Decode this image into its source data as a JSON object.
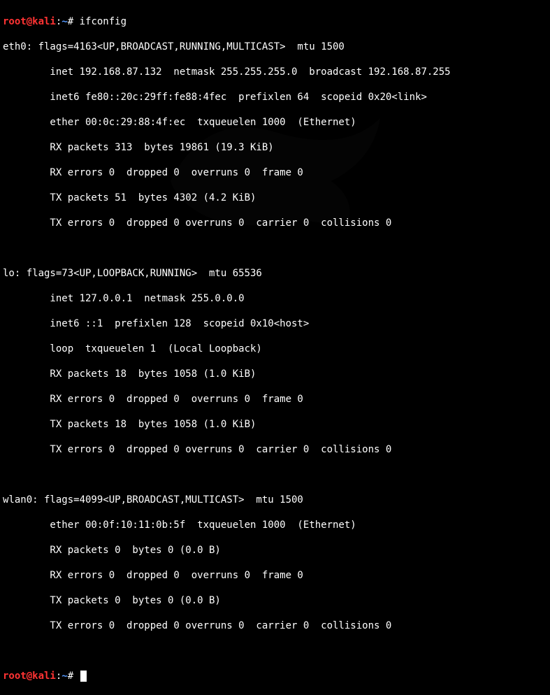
{
  "prompt": {
    "user_host": "root@kali",
    "colon": ":",
    "path": "~",
    "hash": "# "
  },
  "command1": "ifconfig",
  "iface_eth0": {
    "l1": "eth0: flags=4163<UP,BROADCAST,RUNNING,MULTICAST>  mtu 1500",
    "l2": "        inet 192.168.87.132  netmask 255.255.255.0  broadcast 192.168.87.255",
    "l3": "        inet6 fe80::20c:29ff:fe88:4fec  prefixlen 64  scopeid 0x20<link>",
    "l4": "        ether 00:0c:29:88:4f:ec  txqueuelen 1000  (Ethernet)",
    "l5": "        RX packets 313  bytes 19861 (19.3 KiB)",
    "l6": "        RX errors 0  dropped 0  overruns 0  frame 0",
    "l7": "        TX packets 51  bytes 4302 (4.2 KiB)",
    "l8": "        TX errors 0  dropped 0 overruns 0  carrier 0  collisions 0"
  },
  "iface_lo": {
    "l1": "lo: flags=73<UP,LOOPBACK,RUNNING>  mtu 65536",
    "l2": "        inet 127.0.0.1  netmask 255.0.0.0",
    "l3": "        inet6 ::1  prefixlen 128  scopeid 0x10<host>",
    "l4": "        loop  txqueuelen 1  (Local Loopback)",
    "l5": "        RX packets 18  bytes 1058 (1.0 KiB)",
    "l6": "        RX errors 0  dropped 0  overruns 0  frame 0",
    "l7": "        TX packets 18  bytes 1058 (1.0 KiB)",
    "l8": "        TX errors 0  dropped 0 overruns 0  carrier 0  collisions 0"
  },
  "iface_wlan0": {
    "l1": "wlan0: flags=4099<UP,BROADCAST,MULTICAST>  mtu 1500",
    "l2": "        ether 00:0f:10:11:0b:5f  txqueuelen 1000  (Ethernet)",
    "l3": "        RX packets 0  bytes 0 (0.0 B)",
    "l4": "        RX errors 0  dropped 0  overruns 0  frame 0",
    "l5": "        TX packets 0  bytes 0 (0.0 B)",
    "l6": "        TX errors 0  dropped 0 overruns 0  carrier 0  collisions 0"
  }
}
